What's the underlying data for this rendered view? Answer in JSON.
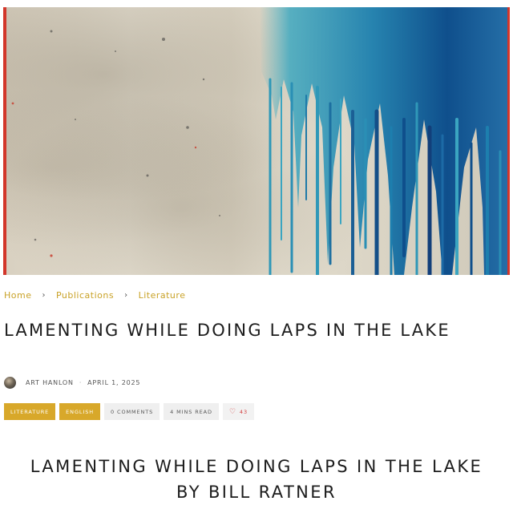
{
  "hero": {
    "image": "abstract-blue-paint-drip-art"
  },
  "breadcrumb": {
    "items": [
      {
        "label": "Home"
      },
      {
        "label": "Publications"
      },
      {
        "label": "Literature"
      }
    ],
    "separator": "›"
  },
  "article": {
    "title": "LAMENTING WHILE DOING LAPS IN THE LAKE",
    "author": "ART HANLON",
    "date": "APRIL 1, 2025",
    "meta_separator": "·",
    "tags": {
      "category": "LITERATURE",
      "language": "ENGLISH",
      "comments": "0 COMMENTS",
      "read_time": "4 MINS READ",
      "likes": "43"
    },
    "content_heading": "LAMENTING WHILE DOING LAPS IN THE LAKE BY BILL RATNER"
  },
  "colors": {
    "accent": "#c9a227",
    "tag_gold": "#d8a82a",
    "like_red": "#d23a3a",
    "hero_border": "#d2362a"
  }
}
